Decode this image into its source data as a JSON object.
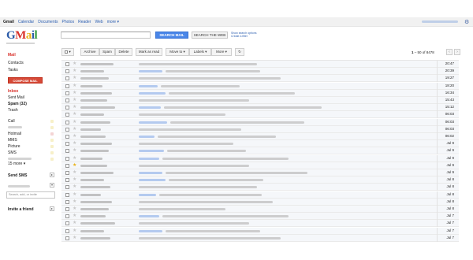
{
  "topnav": {
    "links": [
      "Gmail",
      "Calendar",
      "Documents",
      "Photos",
      "Reader",
      "Web",
      "more ▾"
    ],
    "gear_icon": "gear-icon"
  },
  "logo": {
    "text": "Gmail"
  },
  "search": {
    "placeholder": "",
    "search_mail_label": "SEARCH MAIL",
    "search_web_label": "SEARCH THE WEB",
    "options": [
      "Show search options",
      "Create a filter"
    ]
  },
  "sidebar": {
    "mail": "Mail",
    "contacts": "Contacts",
    "tasks": "Tasks",
    "compose": "COMPOSE MAIL",
    "inbox": "Inbox",
    "sent": "Sent Mail",
    "spam": "Spam (32)",
    "trash": "Trash",
    "labels": [
      {
        "name": "Call",
        "color": "#f7f0c8"
      },
      {
        "name": "",
        "color": "#f7f0c8"
      },
      {
        "name": "Hotmail",
        "color": "#f4d4d4"
      },
      {
        "name": "MMS",
        "color": "#f7f0c8"
      },
      {
        "name": "Picture",
        "color": "#f7f0c8"
      },
      {
        "name": "SMS",
        "color": "#f7f0c8"
      },
      {
        "name": "",
        "color": "#f7f0c8"
      }
    ],
    "more": "15 more ▾",
    "send_sms": "Send SMS",
    "chat_search_placeholder": "Search, add, or invite",
    "invite": "Invite a friend"
  },
  "toolbar": {
    "buttons": [
      "Archive",
      "Spam",
      "Delete",
      "Mark as read",
      "Move to ▾",
      "Labels ▾",
      "More ▾",
      "↻"
    ],
    "pager_start": "1",
    "pager_rest": " – 50 of 8478"
  },
  "messages": [
    {
      "date": "20:47",
      "starred": false
    },
    {
      "date": "20:39",
      "starred": false
    },
    {
      "date": "19:27",
      "starred": false
    },
    {
      "date": "18:20",
      "starred": false
    },
    {
      "date": "16:34",
      "starred": false
    },
    {
      "date": "15:43",
      "starred": false
    },
    {
      "date": "15:12",
      "starred": false
    },
    {
      "date": "06:03",
      "starred": false
    },
    {
      "date": "06:03",
      "starred": false
    },
    {
      "date": "06:03",
      "starred": false
    },
    {
      "date": "06:02",
      "starred": false
    },
    {
      "date": "Jul 9",
      "starred": false
    },
    {
      "date": "Jul 9",
      "starred": false
    },
    {
      "date": "Jul 9",
      "starred": false
    },
    {
      "date": "Jul 9",
      "starred": true
    },
    {
      "date": "Jul 9",
      "starred": false
    },
    {
      "date": "Jul 8",
      "starred": false
    },
    {
      "date": "Jul 8",
      "starred": false
    },
    {
      "date": "Jul 8",
      "starred": false
    },
    {
      "date": "Jul 8",
      "starred": false
    },
    {
      "date": "Jul 8",
      "starred": false
    },
    {
      "date": "Jul 7",
      "starred": false
    },
    {
      "date": "Jul 7",
      "starred": false
    },
    {
      "date": "Jul 7",
      "starred": false
    },
    {
      "date": "Jul 7",
      "starred": false
    }
  ]
}
